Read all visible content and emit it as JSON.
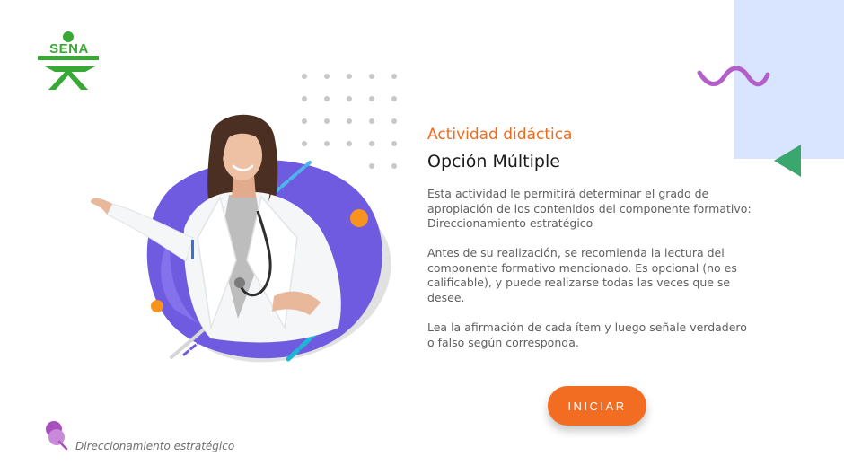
{
  "brand": {
    "logo_text": "SENA",
    "color": "#39a935"
  },
  "activity": {
    "kicker": "Actividad didáctica",
    "title": "Opción Múltiple",
    "paragraphs": [
      "Esta actividad le permitirá determinar el grado de apropiación de los contenidos del componente formativo: Direccionamiento estratégico",
      "Antes de su realización, se recomienda la lectura del componente formativo mencionado.  Es opcional (no es calificable), y puede realizarse todas las veces que se desee.",
      "Lea la afirmación de cada ítem y luego señale verdadero o falso según corresponda."
    ]
  },
  "start_button": {
    "label": "INICIAR"
  },
  "footer": {
    "label": "Direccionamiento estratégico"
  },
  "colors": {
    "accent_orange": "#f26d21",
    "kicker_orange": "#f06b1d",
    "blob_purple": "#6f5be0",
    "panel_blue": "#d9e4ff",
    "triangle_green": "#3aa76d",
    "wave_purple": "#b45ec9",
    "pin_purple": "#a74fbf"
  },
  "icons": [
    "sena-logo-icon",
    "wave-icon",
    "triangle-left-icon",
    "pushpin-icon"
  ]
}
